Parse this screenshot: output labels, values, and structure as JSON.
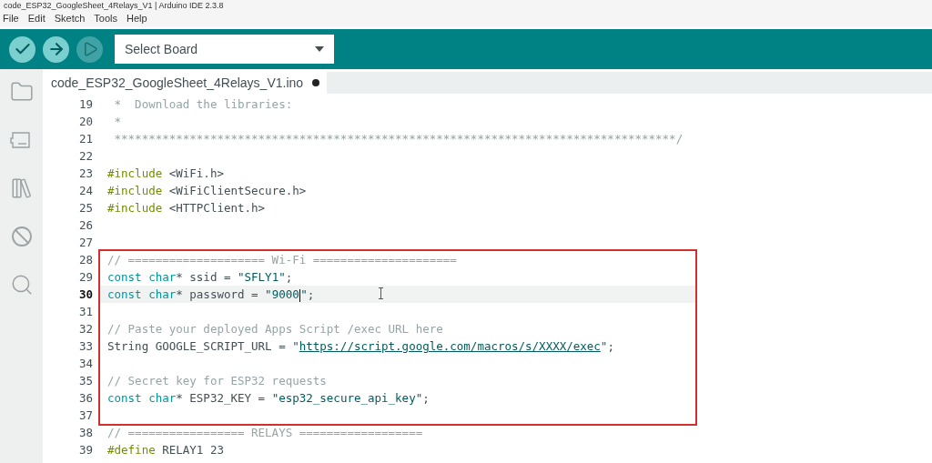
{
  "window": {
    "title": "code_ESP32_GoogleSheet_4Relays_V1 | Arduino IDE 2.3.8"
  },
  "menu": [
    "File",
    "Edit",
    "Sketch",
    "Tools",
    "Help"
  ],
  "toolbar": {
    "buttons": [
      {
        "kind": "verify",
        "disabled": false
      },
      {
        "kind": "upload",
        "disabled": false
      },
      {
        "kind": "debug",
        "disabled": true
      }
    ],
    "board_select": {
      "value": "Select Board"
    }
  },
  "tabs": [
    {
      "label": "code_ESP32_GoogleSheet_4Relays_V1.ino",
      "selected": true,
      "modified": true
    }
  ],
  "sidebar": {
    "items": [
      {
        "kind": "sketchbook",
        "selected": false
      },
      {
        "kind": "boards",
        "selected": false
      },
      {
        "kind": "library",
        "selected": false
      },
      {
        "kind": "debug",
        "selected": false
      },
      {
        "kind": "search",
        "selected": false
      }
    ]
  },
  "code_blocks": [
    {
      "kind": "plain",
      "lines": [
        {
          "number": "19",
          "current": false,
          "tokens": [
            {
              "kind": "comment",
              "text": " *  Download the libraries:"
            }
          ]
        },
        {
          "number": "20",
          "current": false,
          "tokens": [
            {
              "kind": "comment",
              "text": " *"
            }
          ]
        },
        {
          "number": "21",
          "current": false,
          "tokens": [
            {
              "kind": "comment",
              "text": " **********************************************************************************/"
            }
          ]
        },
        {
          "number": "22",
          "current": false
        },
        {
          "number": "23",
          "current": false,
          "tokens": [
            {
              "kind": "preproc",
              "text": "#include"
            },
            {
              "kind": "plain",
              "text": " <WiFi.h>"
            }
          ]
        },
        {
          "number": "24",
          "current": false,
          "tokens": [
            {
              "kind": "preproc",
              "text": "#include"
            },
            {
              "kind": "plain",
              "text": " <WiFiClientSecure.h>"
            }
          ]
        },
        {
          "number": "25",
          "current": false,
          "tokens": [
            {
              "kind": "preproc",
              "text": "#include"
            },
            {
              "kind": "plain",
              "text": " <HTTPClient.h>"
            }
          ]
        },
        {
          "number": "26",
          "current": false
        },
        {
          "number": "27",
          "current": false
        }
      ]
    },
    {
      "kind": "annotation_box",
      "lines": [
        {
          "number": "28",
          "current": false,
          "tokens": [
            {
              "kind": "comment",
              "text": "// ==================== Wi-Fi ====================="
            }
          ]
        },
        {
          "number": "29",
          "current": false,
          "tokens": [
            {
              "kind": "keyword",
              "text": "const char"
            },
            {
              "kind": "plain",
              "text": "* ssid = "
            },
            {
              "kind": "string",
              "text": "\"SFLY1\""
            },
            {
              "kind": "plain",
              "text": ";"
            }
          ]
        },
        {
          "number": "30",
          "current": true,
          "tokens": [
            {
              "kind": "keyword",
              "text": "const char"
            },
            {
              "kind": "plain",
              "text": "* password = "
            },
            {
              "kind": "string",
              "text": "\"9000"
            },
            {
              "kind": "cursor"
            },
            {
              "kind": "string",
              "text": "\""
            },
            {
              "kind": "plain",
              "text": ";"
            }
          ]
        },
        {
          "number": "31",
          "current": false
        },
        {
          "number": "32",
          "current": false,
          "tokens": [
            {
              "kind": "comment",
              "text": "// Paste your deployed Apps Script /exec URL here"
            }
          ]
        },
        {
          "number": "33",
          "current": false,
          "tokens": [
            {
              "kind": "plain",
              "text": "String GOOGLE_SCRIPT_URL = \""
            },
            {
              "kind": "link",
              "text": "https://script.google.com/macros/s/XXXX/exec"
            },
            {
              "kind": "plain",
              "text": "\";"
            }
          ]
        },
        {
          "number": "34",
          "current": false
        },
        {
          "number": "35",
          "current": false,
          "tokens": [
            {
              "kind": "comment",
              "text": "// Secret key for ESP32 requests"
            }
          ]
        },
        {
          "number": "36",
          "current": false,
          "tokens": [
            {
              "kind": "keyword",
              "text": "const char"
            },
            {
              "kind": "plain",
              "text": "* ESP32_KEY = "
            },
            {
              "kind": "string",
              "text": "\"esp32_secure_api_key\""
            },
            {
              "kind": "plain",
              "text": ";"
            }
          ]
        },
        {
          "number": "37",
          "current": false
        }
      ]
    },
    {
      "kind": "plain",
      "lines": [
        {
          "number": "38",
          "current": false,
          "tokens": [
            {
              "kind": "comment",
              "text": "// ================= RELAYS =================="
            }
          ]
        },
        {
          "number": "39",
          "current": false,
          "tokens": [
            {
              "kind": "preproc",
              "text": "#define"
            },
            {
              "kind": "plain",
              "text": " RELAY1 23"
            }
          ]
        }
      ]
    }
  ]
}
